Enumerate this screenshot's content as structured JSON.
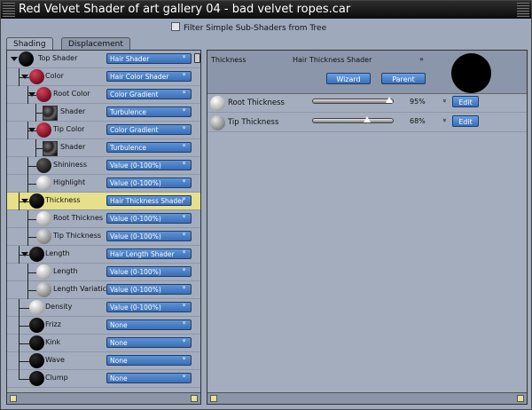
{
  "window": {
    "title": "Red Velvet Shader of art gallery 04 - bad velvet ropes.car"
  },
  "filter": {
    "label": "Filter Simple Sub-Shaders from Tree",
    "checked": false
  },
  "tabs": [
    {
      "label": "Shading",
      "active": true
    },
    {
      "label": "Displacement",
      "active": false
    }
  ],
  "tree": {
    "rows": [
      {
        "label": "Top Shader",
        "value": "Hair Shader",
        "icon": "black-sphere",
        "depth": 0
      },
      {
        "label": "Color",
        "value": "Hair Color Shader",
        "icon": "red-sphere",
        "depth": 1
      },
      {
        "label": "Root Color",
        "value": "Color Gradient",
        "icon": "red-sphere",
        "depth": 2
      },
      {
        "label": "Shader",
        "value": "Turbulence",
        "icon": "texture-swatch",
        "depth": 3
      },
      {
        "label": "Tip Color",
        "value": "Color Gradient",
        "icon": "red-sphere",
        "depth": 2
      },
      {
        "label": "Shader",
        "value": "Turbulence",
        "icon": "texture-swatch",
        "depth": 3
      },
      {
        "label": "Shininess",
        "value": "Value (0-100%)",
        "icon": "dark-sphere",
        "depth": 2
      },
      {
        "label": "Highlight",
        "value": "Value (0-100%)",
        "icon": "white-sphere",
        "depth": 2
      },
      {
        "label": "Thickness",
        "value": "Hair Thickness Shader",
        "icon": "black-sphere",
        "depth": 1,
        "selected": true
      },
      {
        "label": "Root Thicknes",
        "value": "Value (0-100%)",
        "icon": "white-sphere",
        "depth": 2
      },
      {
        "label": "Tip Thickness",
        "value": "Value (0-100%)",
        "icon": "grey-sphere",
        "depth": 2
      },
      {
        "label": "Length",
        "value": "Hair Length Shader",
        "icon": "black-sphere",
        "depth": 1
      },
      {
        "label": "Length",
        "value": "Value (0-100%)",
        "icon": "white-sphere",
        "depth": 2
      },
      {
        "label": "Length Variatic",
        "value": "Value (0-100%)",
        "icon": "grey-sphere",
        "depth": 2
      },
      {
        "label": "Density",
        "value": "Value (0-100%)",
        "icon": "white-sphere",
        "depth": 1
      },
      {
        "label": "Frizz",
        "value": "None",
        "icon": "black-sphere",
        "depth": 1
      },
      {
        "label": "Kink",
        "value": "None",
        "icon": "black-sphere",
        "depth": 1
      },
      {
        "label": "Wave",
        "value": "None",
        "icon": "black-sphere",
        "depth": 1
      },
      {
        "label": "Clump",
        "value": "None",
        "icon": "black-sphere",
        "depth": 1
      }
    ]
  },
  "detail": {
    "title": "Thickness",
    "shader": "Hair Thickness Shader",
    "wizard_label": "Wizard",
    "parent_label": "Parent",
    "params": [
      {
        "label": "Root Thickness",
        "percent": "95%",
        "value": 0.95,
        "edit_label": "Edit",
        "icon": "white-sphere"
      },
      {
        "label": "Tip Thickness",
        "percent": "68%",
        "value": 0.68,
        "edit_label": "Edit",
        "icon": "grey-sphere"
      }
    ]
  },
  "colors": {
    "selection": "#e6e08a",
    "dropdown": "#3b6fb6",
    "panel": "#a3adbd"
  }
}
